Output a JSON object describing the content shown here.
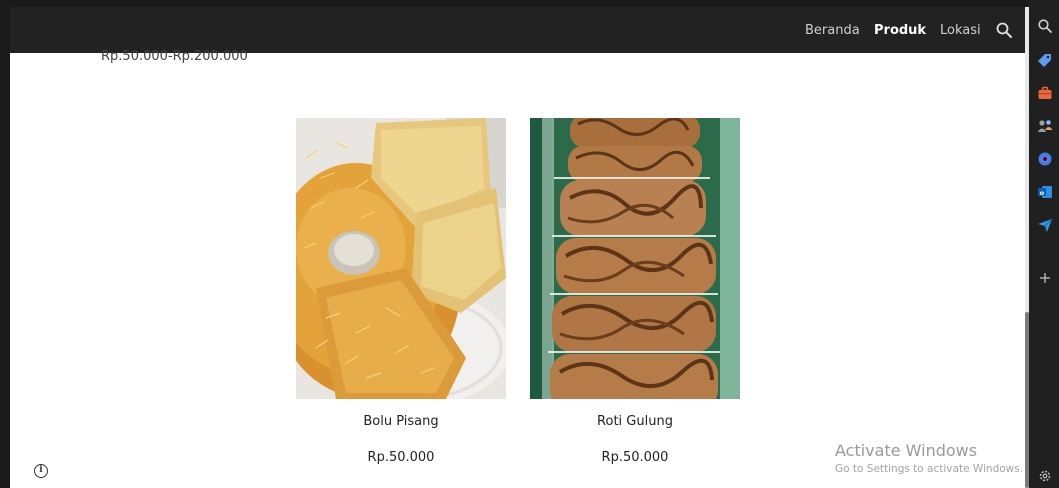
{
  "nav": {
    "items": [
      {
        "label": "Beranda",
        "active": false
      },
      {
        "label": "Produk",
        "active": true
      },
      {
        "label": "Lokasi",
        "active": false
      }
    ],
    "search_icon": "search-icon"
  },
  "filter": {
    "price_range": "Rp.50.000-Rp.200.000"
  },
  "products": [
    {
      "name": "Bolu Pisang",
      "price": "Rp.50.000",
      "image": "banana-cake-photo"
    },
    {
      "name": "Roti Gulung",
      "price": "Rp.50.000",
      "image": "swiss-roll-photo"
    }
  ],
  "footer": {
    "info_icon": "info-icon"
  },
  "watermark": {
    "title": "Activate Windows",
    "subtitle": "Go to Settings to activate Windows."
  },
  "sidebar": {
    "icons": [
      "search-icon",
      "tag-icon",
      "briefcase-icon",
      "people-icon",
      "copilot-icon",
      "outlook-icon",
      "send-icon",
      "add-icon",
      "settings-icon"
    ]
  },
  "colors": {
    "navbar_bg": "#222222",
    "sidebar_bg": "#202020",
    "page_bg": "#ffffff"
  }
}
